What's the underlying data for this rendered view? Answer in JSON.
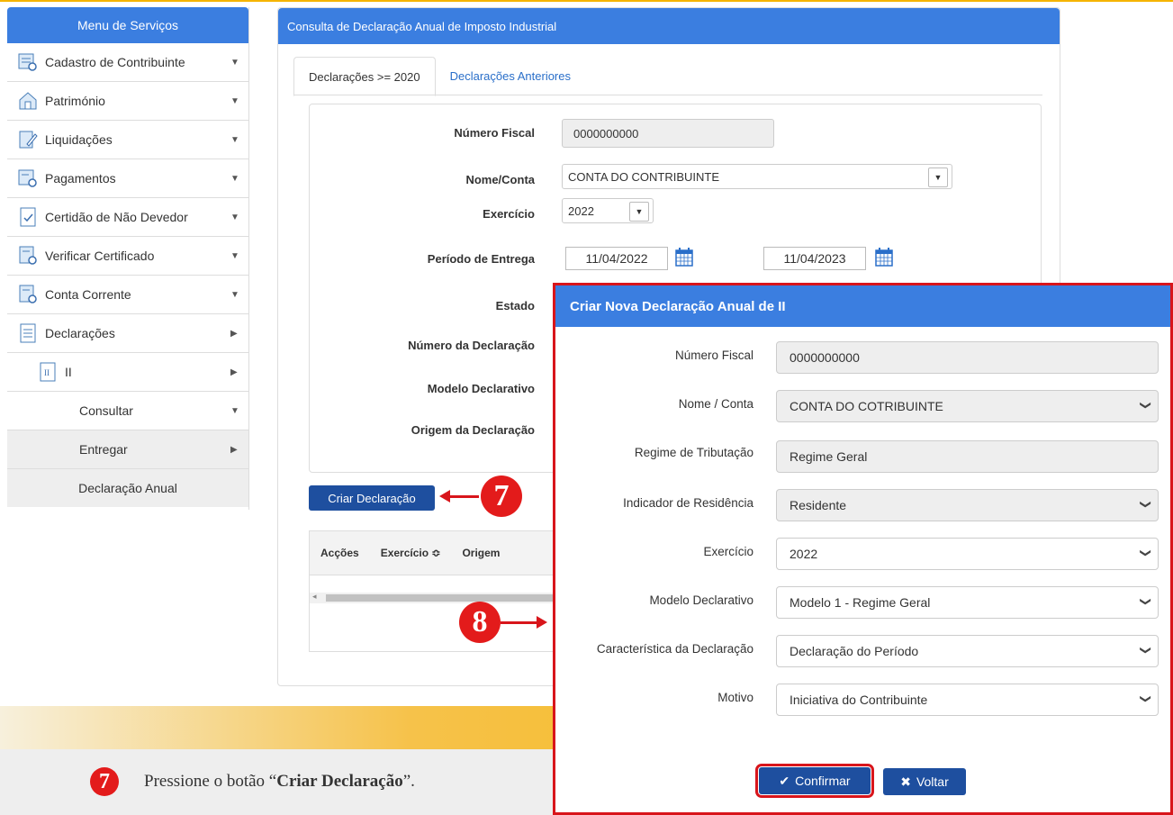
{
  "sidebar": {
    "title": "Menu de Serviços",
    "items": [
      {
        "label": "Cadastro de Contribuinte",
        "icon": "contributor-register-icon"
      },
      {
        "label": "Património",
        "icon": "house-icon"
      },
      {
        "label": "Liquidações",
        "icon": "edit-document-icon"
      },
      {
        "label": "Pagamentos",
        "icon": "payment-card-icon"
      },
      {
        "label": "Certidão de Não Devedor",
        "icon": "certificate-check-icon"
      },
      {
        "label": "Verificar Certificado",
        "icon": "verify-certificate-icon"
      },
      {
        "label": "Conta Corrente",
        "icon": "current-account-icon"
      },
      {
        "label": "Declarações",
        "icon": "declarations-icon"
      },
      {
        "label": "II",
        "icon": "ii-document-icon"
      },
      {
        "label": "Consultar"
      },
      {
        "label": "Entregar"
      },
      {
        "label": "Declaração Anual"
      }
    ]
  },
  "panel": {
    "title": "Consulta de Declaração Anual de Imposto Industrial",
    "tabs": [
      "Declarações >= 2020",
      "Declarações Anteriores"
    ],
    "labels": {
      "nif": "Número Fiscal",
      "nome": "Nome/Conta",
      "exercicio": "Exercício",
      "periodo": "Período de Entrega",
      "estado": "Estado",
      "numero": "Número da Declaração",
      "modelo": "Modelo Declarativo",
      "origem": "Origem da Declaração"
    },
    "values": {
      "nif": "0000000000",
      "nome": "CONTA DO CONTRIBUINTE",
      "exercicio": "2022",
      "data_inicio": "11/04/2022",
      "data_fim": "11/04/2023"
    },
    "create_button": "Criar Declaração",
    "table_columns": [
      "Acções",
      "Exercício ≎",
      "Origem"
    ]
  },
  "modal": {
    "title": "Criar Nova Declaração Anual de II",
    "fields": [
      {
        "label": "Número Fiscal",
        "value": "0000000000",
        "type": "readonly"
      },
      {
        "label": "Nome / Conta",
        "value": "CONTA DO COTRIBUINTE",
        "type": "select"
      },
      {
        "label": "Regime de Tributação",
        "value": "Regime Geral",
        "type": "readonly"
      },
      {
        "label": "Indicador de Residência",
        "value": "Residente",
        "type": "select-ro"
      },
      {
        "label": "Exercício",
        "value": "2022",
        "type": "select"
      },
      {
        "label": "Modelo Declarativo",
        "value": "Modelo 1 - Regime Geral",
        "type": "select"
      },
      {
        "label": "Característica da Declaração",
        "value": "Declaração do Período",
        "type": "select"
      },
      {
        "label": "Motivo",
        "value": "Iniciativa do Contribuinte",
        "type": "select"
      }
    ],
    "confirm": "Confirmar",
    "back": "Voltar"
  },
  "steps": {
    "seven": "7",
    "eight": "8"
  },
  "footer": {
    "prefix": "Pressione o botão “",
    "bold": "Criar Declaração",
    "suffix": "”."
  },
  "colors": {
    "header_blue": "#3b7ee0",
    "button_navy": "#1e4f9f",
    "highlight_red": "#d8151b",
    "banner_orange": "#f5b400"
  }
}
